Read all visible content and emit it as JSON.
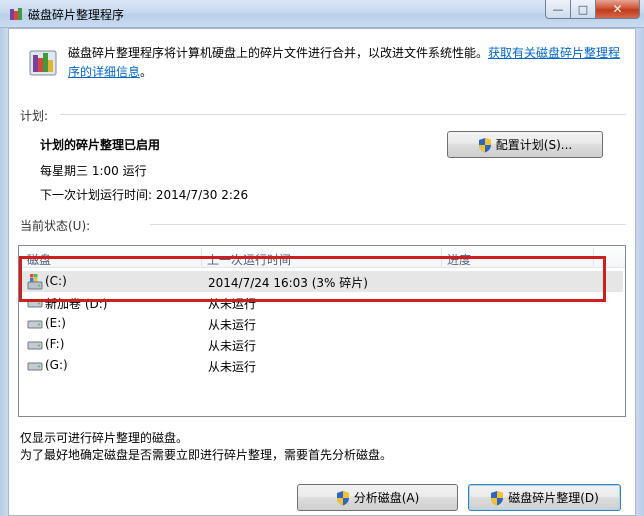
{
  "window": {
    "title": "磁盘碎片整理程序",
    "controls": {
      "minimize": "—",
      "maximize": "□",
      "close": "✕"
    }
  },
  "description": {
    "text": "磁盘碎片整理程序将计算机硬盘上的碎片文件进行合并，以改进文件系统性能。",
    "link": "获取有关磁盘碎片整理程序的详细信息",
    "trailing": "。"
  },
  "schedule": {
    "section_label": "计划:",
    "status": "计划的碎片整理已启用",
    "frequency": "每星期三  1:00 运行",
    "next_run": "下一次计划运行时间: 2014/7/30 2:26",
    "configure_button": "配置计划(S)..."
  },
  "current_status": {
    "section_label": "当前状态(U):",
    "columns": [
      "磁盘",
      "上一次运行时间",
      "进度"
    ],
    "disks": [
      {
        "name": "(C:)",
        "last_run": "2014/7/24 16:03 (3% 碎片)",
        "icon": "system-drive-icon"
      },
      {
        "name": "新加卷 (D:)",
        "last_run": "从未运行",
        "icon": "drive-icon"
      },
      {
        "name": "(E:)",
        "last_run": "从未运行",
        "icon": "drive-icon"
      },
      {
        "name": "(F:)",
        "last_run": "从未运行",
        "icon": "drive-icon"
      },
      {
        "name": "(G:)",
        "last_run": "从未运行",
        "icon": "drive-icon"
      }
    ],
    "selected_index": 0
  },
  "notes": {
    "line1": "仅显示可进行碎片整理的磁盘。",
    "line2": "为了最好地确定磁盘是否需要立即进行碎片整理，需要首先分析磁盘。"
  },
  "actions": {
    "analyze_button": "分析磁盘(A)",
    "defrag_button": "磁盘碎片整理(D)"
  },
  "colors": {
    "link": "#0066cc",
    "highlight_box": "#cc1f1f",
    "selected_row": "#e6e6e6"
  }
}
